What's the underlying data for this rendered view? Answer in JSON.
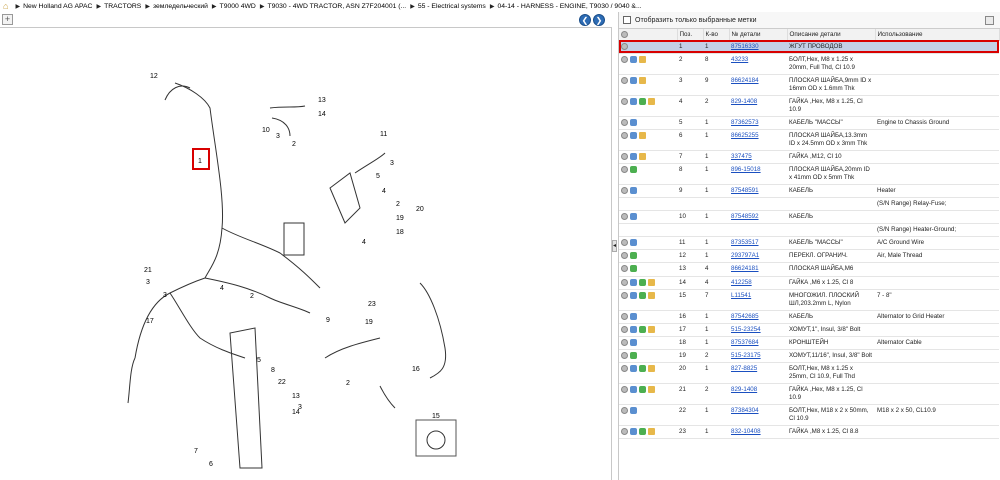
{
  "breadcrumbs": [
    "New Holland AG APAC",
    "TRACTORS",
    "земледельческий",
    "T9000 4WD",
    "T9030 - 4WD TRACTOR, ASN Z7F204001 (...",
    "55 - Electrical systems",
    "04-14 - HARNESS - ENGINE, T9030 / 9040 &..."
  ],
  "filter": {
    "label": "Отобразить только выбранные метки"
  },
  "table": {
    "headers": {
      "pos": "Поз.",
      "qty": "К-во",
      "part": "№ детали",
      "desc": "Описание детали",
      "use": "Использование"
    },
    "rows": [
      {
        "pos": "1",
        "qty": "1",
        "part": "87516330",
        "desc": "ЖГУТ ПРОВОДОВ",
        "use": "",
        "icons": [
          "info"
        ],
        "selected": true
      },
      {
        "pos": "2",
        "qty": "8",
        "part": "43233",
        "desc": "БОЛТ,Hex, M8 x 1.25 x 20mm, Full Thd, Cl 10.9",
        "use": "",
        "icons": [
          "info",
          "back",
          "box"
        ]
      },
      {
        "pos": "3",
        "qty": "9",
        "part": "86624184",
        "desc": "ПЛОСКАЯ ШАЙБА,9mm ID x 16mm OD x 1.6mm Thk",
        "use": "",
        "icons": [
          "info",
          "back",
          "box"
        ]
      },
      {
        "pos": "4",
        "qty": "2",
        "part": "829-1408",
        "desc": "ГАЙКА ,Hex, M8 x 1.25, Cl 10.9",
        "use": "",
        "icons": [
          "info",
          "back",
          "fwd",
          "box"
        ]
      },
      {
        "pos": "5",
        "qty": "1",
        "part": "87362573",
        "desc": "КАБЕЛЬ \"МАССЫ\"",
        "use": "Engine to Chassis Ground",
        "icons": [
          "info",
          "back"
        ]
      },
      {
        "pos": "6",
        "qty": "1",
        "part": "86625255",
        "desc": "ПЛОСКАЯ ШАЙБА,13.3mm ID x 24.5mm OD x 3mm Thk",
        "use": "",
        "icons": [
          "info",
          "back",
          "box"
        ]
      },
      {
        "pos": "7",
        "qty": "1",
        "part": "337475",
        "desc": "ГАЙКА ,M12, Cl 10",
        "use": "",
        "icons": [
          "info",
          "back",
          "box"
        ]
      },
      {
        "pos": "8",
        "qty": "1",
        "part": "896-15018",
        "desc": "ПЛОСКАЯ ШАЙБА,20mm ID x 41mm OD x 5mm Thk",
        "use": "",
        "icons": [
          "info",
          "fwd"
        ]
      },
      {
        "pos": "9",
        "qty": "1",
        "part": "87548591",
        "desc": "КАБЕЛЬ",
        "use": "Heater",
        "icons": [
          "info",
          "back"
        ]
      },
      {
        "pos": "",
        "qty": "",
        "part": "",
        "desc": "",
        "use": "(S/N Range) Relay-Fuse;",
        "icons": []
      },
      {
        "pos": "10",
        "qty": "1",
        "part": "87548592",
        "desc": "КАБЕЛЬ",
        "use": "",
        "icons": [
          "info",
          "back"
        ]
      },
      {
        "pos": "",
        "qty": "",
        "part": "",
        "desc": "",
        "use": "(S/N Range) Heater-Ground;",
        "icons": []
      },
      {
        "pos": "11",
        "qty": "1",
        "part": "87353517",
        "desc": "КАБЕЛЬ \"МАССЫ\"",
        "use": "A/C Ground Wire",
        "icons": [
          "info",
          "back"
        ]
      },
      {
        "pos": "12",
        "qty": "1",
        "part": "293797A1",
        "desc": "ПЕРЕКЛ. ОГРАНИЧ.",
        "use": "Air, Male Thread",
        "icons": [
          "info",
          "fwd"
        ]
      },
      {
        "pos": "13",
        "qty": "4",
        "part": "86624181",
        "desc": "ПЛОСКАЯ ШАЙБА,M6",
        "use": "",
        "icons": [
          "info",
          "fwd"
        ]
      },
      {
        "pos": "14",
        "qty": "4",
        "part": "412258",
        "desc": "ГАЙКА ,M6 x 1.25, Cl 8",
        "use": "",
        "icons": [
          "info",
          "back",
          "fwd",
          "box"
        ]
      },
      {
        "pos": "15",
        "qty": "7",
        "part": "L11541",
        "desc": "МНОГОЖИЛ. ПЛОСКИЙ ШЛ,203.2mm L, Nylon",
        "use": "7 - 8\"",
        "icons": [
          "info",
          "back",
          "fwd",
          "box"
        ]
      },
      {
        "pos": "16",
        "qty": "1",
        "part": "87542685",
        "desc": "КАБЕЛЬ",
        "use": "Alternator to Grid Heater",
        "icons": [
          "info",
          "back"
        ]
      },
      {
        "pos": "17",
        "qty": "1",
        "part": "515-23254",
        "desc": "ХОМУТ,1\", Insul, 3/8\" Bolt",
        "use": "",
        "icons": [
          "info",
          "back",
          "fwd",
          "box"
        ]
      },
      {
        "pos": "18",
        "qty": "1",
        "part": "87537684",
        "desc": "КРОНШТЕЙН",
        "use": "Alternator Cable",
        "icons": [
          "info",
          "back"
        ]
      },
      {
        "pos": "19",
        "qty": "2",
        "part": "515-23175",
        "desc": "ХОМУТ,11/16\", Insul, 3/8\" Bolt",
        "use": "",
        "icons": [
          "info",
          "fwd"
        ]
      },
      {
        "pos": "20",
        "qty": "1",
        "part": "827-8825",
        "desc": "БОЛТ,Hex, M8 x 1.25 x 25mm, Cl 10.9, Full Thd",
        "use": "",
        "icons": [
          "info",
          "back",
          "fwd",
          "box"
        ]
      },
      {
        "pos": "21",
        "qty": "2",
        "part": "829-1408",
        "desc": "ГАЙКА ,Hex, M8 x 1.25, Cl 10.9",
        "use": "",
        "icons": [
          "info",
          "back",
          "fwd",
          "box"
        ]
      },
      {
        "pos": "22",
        "qty": "1",
        "part": "87384304",
        "desc": "БОЛТ,Hex, M18 x 2 x 50mm, Cl 10.9",
        "use": "M18 x 2 x 50, CL10.9",
        "icons": [
          "info",
          "back"
        ]
      },
      {
        "pos": "23",
        "qty": "1",
        "part": "832-10408",
        "desc": "ГАЙКА ,M8 x 1.25, Cl 8.8",
        "use": "",
        "icons": [
          "info",
          "back",
          "fwd",
          "box"
        ]
      }
    ]
  },
  "diagram_callouts": [
    "12",
    "1",
    "13",
    "14",
    "10",
    "3",
    "2",
    "11",
    "3",
    "5",
    "4",
    "2",
    "20",
    "19",
    "18",
    "4",
    "21",
    "3",
    "3",
    "4",
    "2",
    "17",
    "23",
    "9",
    "19",
    "16",
    "2",
    "5",
    "8",
    "22",
    "3",
    "13",
    "14",
    "15",
    "7",
    "6"
  ],
  "colors": {
    "selected_row": "#c4d0e6",
    "highlight_border": "#d80000",
    "link": "#1a4fc0"
  }
}
